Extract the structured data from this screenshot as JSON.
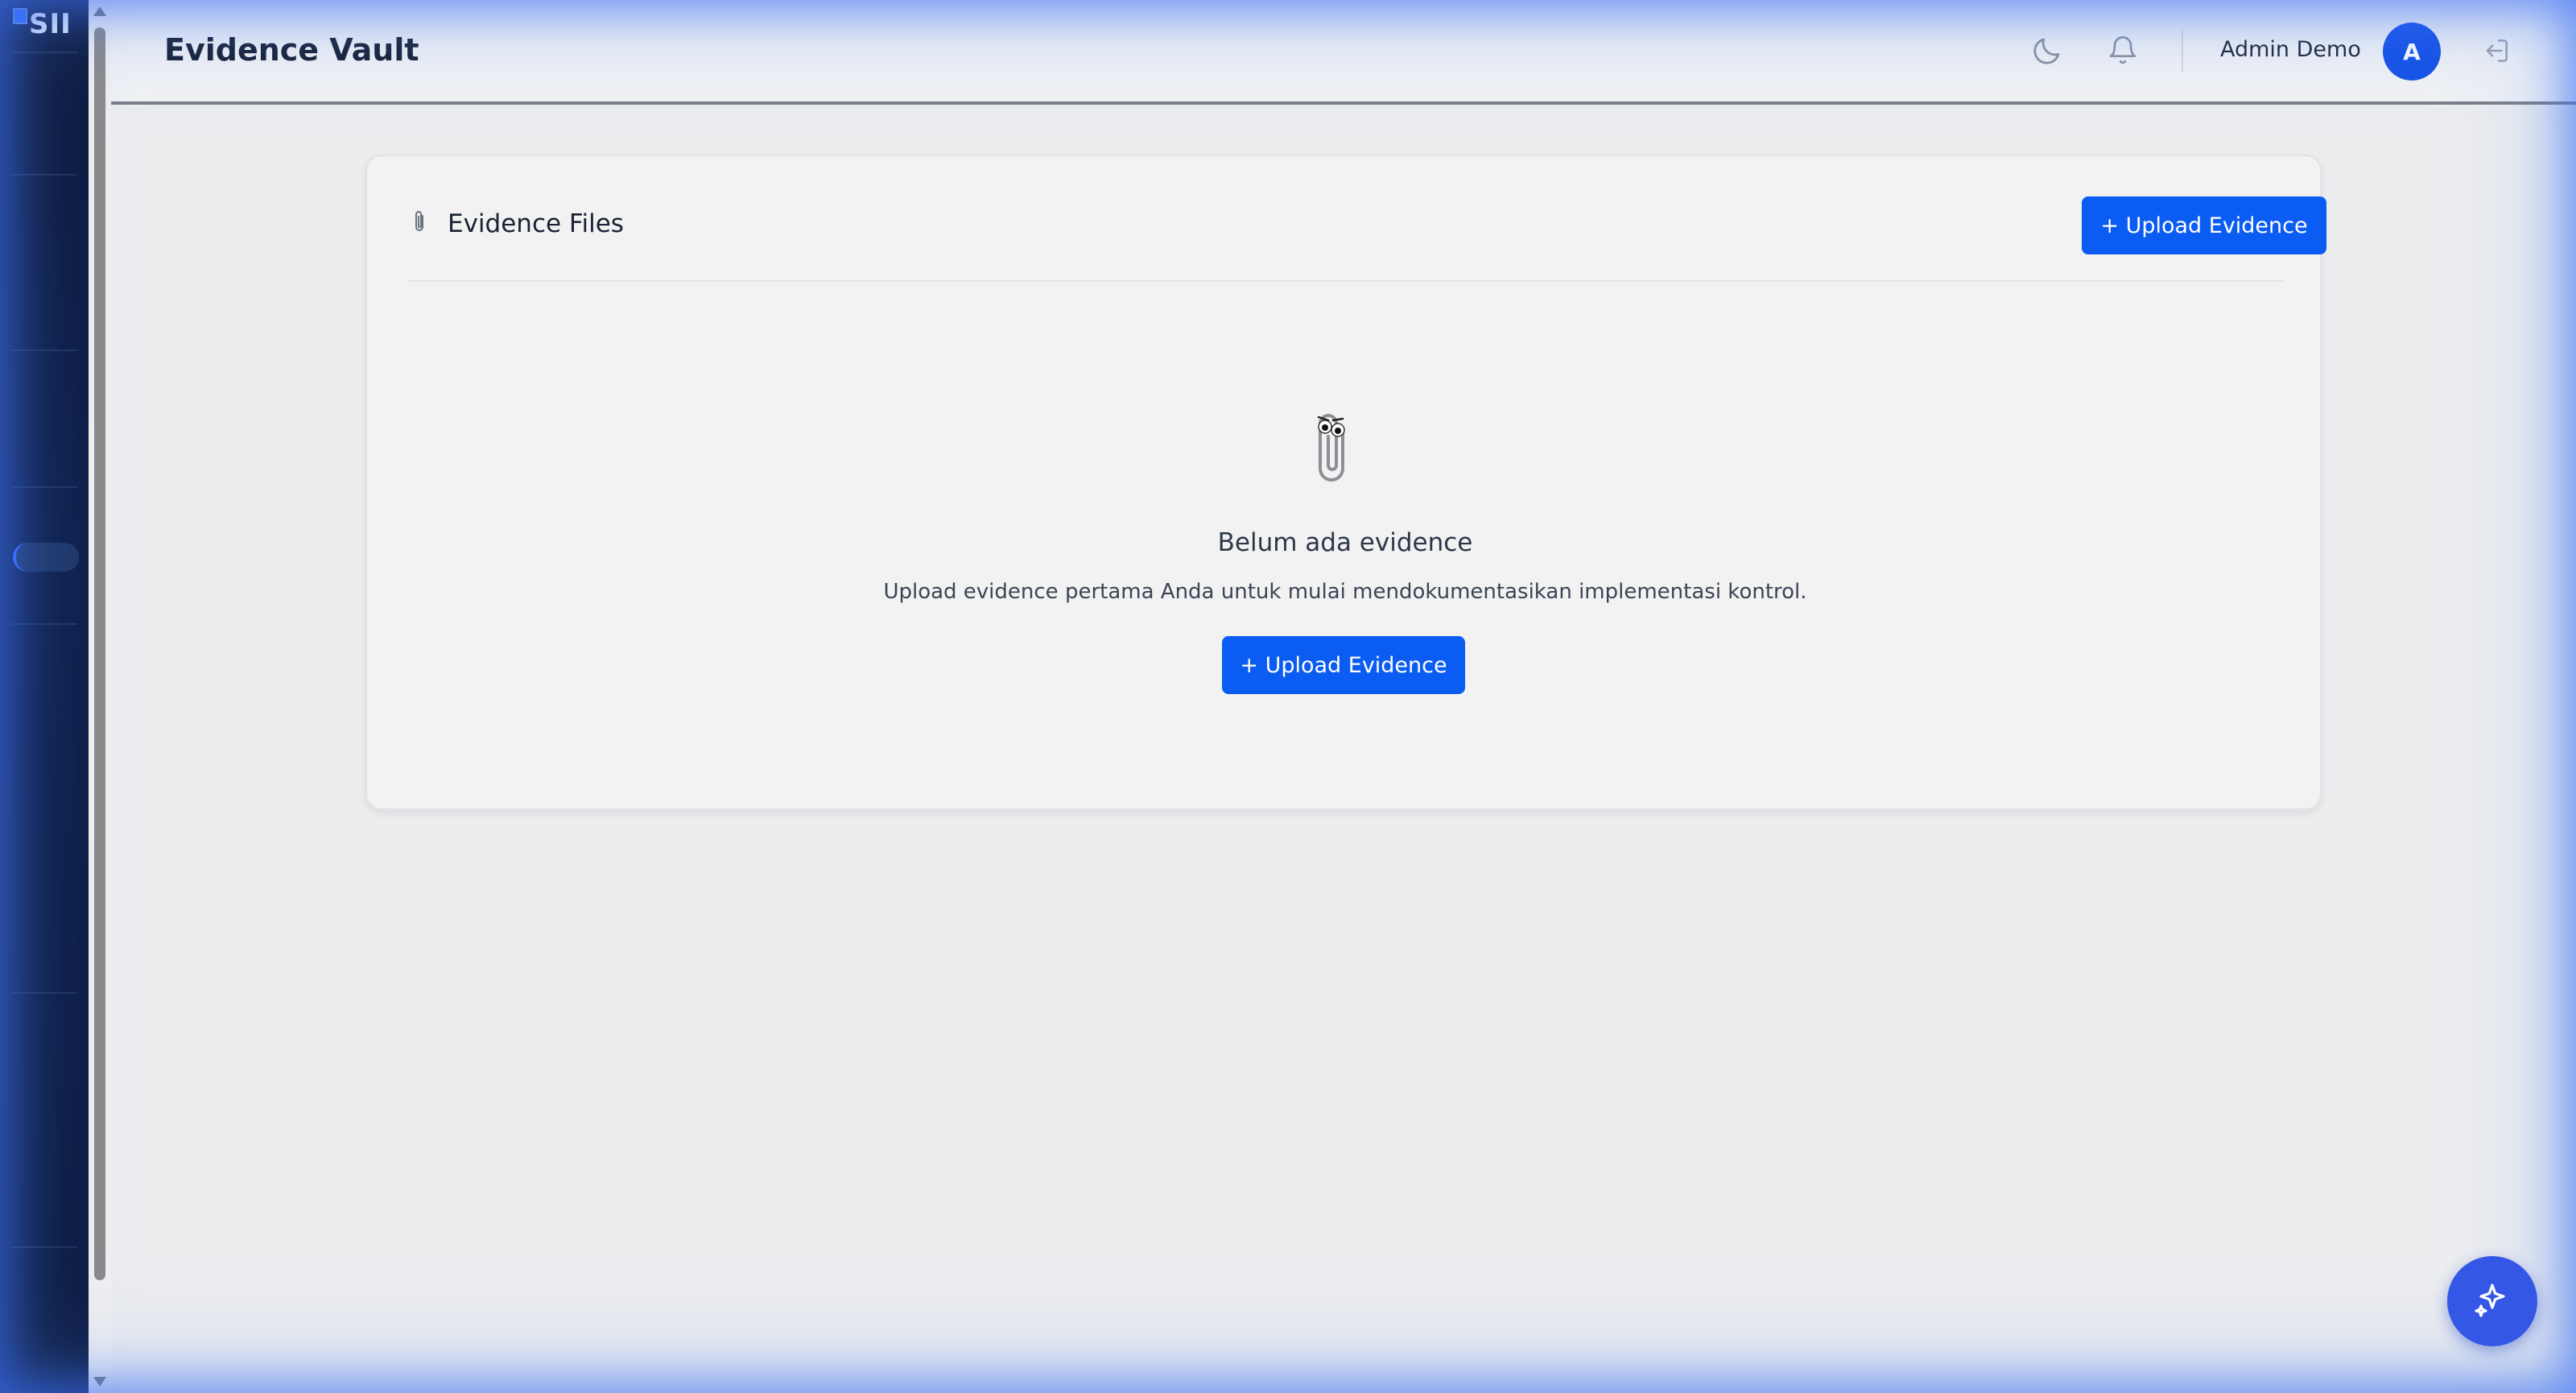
{
  "sidebar": {
    "logo_text": "SII",
    "active_item_color": "#2f6bff"
  },
  "header": {
    "title": "Evidence Vault",
    "theme_toggle_icon": "moon-icon",
    "notifications_icon": "bell-icon",
    "user_name": "Admin Demo",
    "avatar_initial": "A",
    "logout_icon": "logout-icon"
  },
  "card": {
    "icon": "paperclip-icon",
    "title": "Evidence Files",
    "upload_button_label": "+ Upload Evidence",
    "empty_state": {
      "icon": "paperclip-character-icon",
      "title": "Belum ada evidence",
      "description": "Upload evidence pertama Anda untuk mulai mendokumentasikan implementasi kontrol.",
      "button_label": "+ Upload Evidence"
    }
  },
  "fab": {
    "icon": "sparkle-icon"
  },
  "colors": {
    "primary": "#0b5cf2",
    "sidebar_bg": "#0b1838",
    "avatar_bg": "#1552e6",
    "fab_bg": "#3457e6"
  }
}
